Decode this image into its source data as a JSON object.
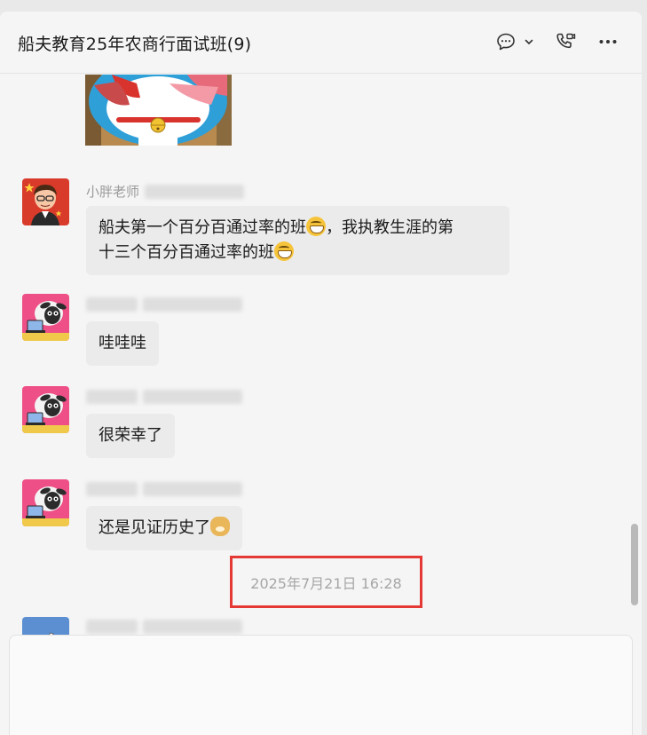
{
  "window": {
    "title": "船夫教育25年农商行面试班(9)"
  },
  "header": {
    "icons": [
      "chat-bubble-icon",
      "chevron-down-icon",
      "phone-video-icon",
      "more-icon"
    ]
  },
  "messages": [
    {
      "type": "image",
      "icon": "doraemon-image"
    },
    {
      "sender": "小胖老师",
      "avatar": "teacher-avatar",
      "text_parts": [
        "船夫第一个百分百通过率的班",
        "，我执教生涯的第",
        "十三个百分百通过率的班"
      ],
      "emojis": [
        "grin-emoji",
        "grin-emoji"
      ]
    },
    {
      "sender": "",
      "avatar": "sheep-avatar",
      "text": "哇哇哇"
    },
    {
      "sender": "",
      "avatar": "sheep-avatar",
      "text": "很荣幸了"
    },
    {
      "sender": "",
      "avatar": "sheep-avatar",
      "text": "还是见证历史了",
      "emojis": [
        "doge-emoji"
      ]
    },
    {
      "type": "timestamp",
      "text": "2025年7月21日 16:28"
    },
    {
      "sender": "",
      "avatar": "plane-avatar",
      "type": "partial"
    }
  ],
  "colors": {
    "highlight_border": "#e53935",
    "bubble_bg": "#ebebeb",
    "window_bg": "#f5f5f5"
  }
}
